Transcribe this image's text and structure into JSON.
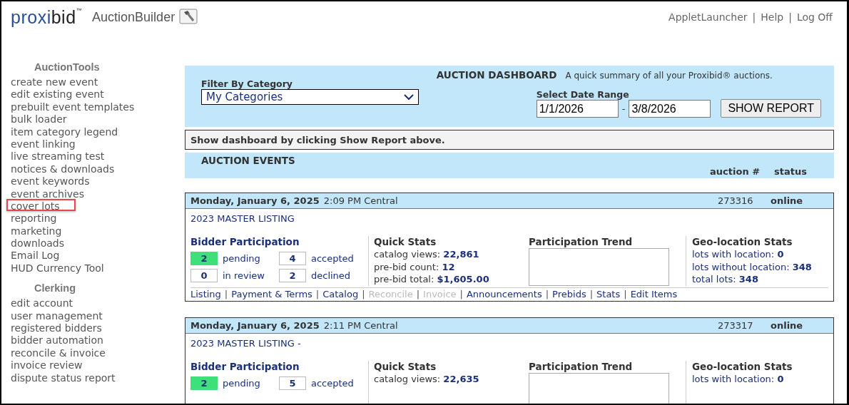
{
  "header": {
    "logo": {
      "first": "proxi",
      "second": "bid",
      "mark": "™"
    },
    "app_name": "AuctionBuilder",
    "links": [
      "AppletLauncher",
      "Help",
      "Log Off"
    ],
    "separator": "|"
  },
  "sidebar": {
    "sections": [
      {
        "title": "AuctionTools",
        "items": [
          {
            "label": "create new event",
            "highlighted": false
          },
          {
            "label": "edit existing event",
            "highlighted": false
          },
          {
            "label": "prebuilt event templates",
            "highlighted": false
          },
          {
            "label": "bulk loader",
            "highlighted": false
          },
          {
            "label": "item category legend",
            "highlighted": false
          },
          {
            "label": "event linking",
            "highlighted": false
          },
          {
            "label": "live streaming test",
            "highlighted": false
          },
          {
            "label": "notices & downloads",
            "highlighted": false
          },
          {
            "label": "event keywords",
            "highlighted": false
          },
          {
            "label": "event archives",
            "highlighted": false
          },
          {
            "label": "cover lots",
            "highlighted": true
          },
          {
            "label": "reporting",
            "highlighted": false
          },
          {
            "label": "marketing",
            "highlighted": false
          },
          {
            "label": "downloads",
            "highlighted": false
          },
          {
            "label": "Email Log",
            "highlighted": false
          },
          {
            "label": "HUD Currency Tool",
            "highlighted": false
          }
        ]
      },
      {
        "title": "Clerking",
        "items": [
          {
            "label": "edit account",
            "highlighted": false
          },
          {
            "label": "user management",
            "highlighted": false
          },
          {
            "label": "registered bidders",
            "highlighted": false
          },
          {
            "label": "bidder automation",
            "highlighted": false
          },
          {
            "label": "reconcile & invoice",
            "highlighted": false
          },
          {
            "label": "invoice review",
            "highlighted": false
          },
          {
            "label": "dispute status report",
            "highlighted": false
          }
        ]
      }
    ]
  },
  "dashboard": {
    "filter_label": "Filter By Category",
    "filter_value": "My Categories",
    "title": "AUCTION DASHBOARD",
    "description": "A quick summary of all your Proxibid® auctions.",
    "date_label": "Select Date Range",
    "date_from": "1/1/2026",
    "date_dash": "-",
    "date_to": "3/8/2026",
    "button": "SHOW REPORT",
    "message": "Show dashboard by clicking Show Report above."
  },
  "events_header": {
    "title": "AUCTION EVENTS",
    "columns": [
      "auction #",
      "status"
    ]
  },
  "events": [
    {
      "date": "Monday, January 6, 2025",
      "time": "2:09 PM Central",
      "auction_number": "273316",
      "status": "online",
      "title": "2023 MASTER LISTING",
      "bidder": {
        "heading": "Bidder Participation",
        "counts": [
          {
            "value": "2",
            "label": "pending",
            "highlighted": true
          },
          {
            "value": "4",
            "label": "accepted",
            "highlighted": false
          },
          {
            "value": "0",
            "label": "in review",
            "highlighted": false
          },
          {
            "value": "2",
            "label": "declined",
            "highlighted": false
          }
        ]
      },
      "quick_stats": {
        "heading": "Quick Stats",
        "rows": [
          {
            "label": "catalog views:",
            "value": "22,861"
          },
          {
            "label": "pre-bid count:",
            "value": "12"
          },
          {
            "label": "pre-bid total:",
            "value": "$1,605.00"
          }
        ]
      },
      "trend": {
        "heading": "Participation Trend"
      },
      "geo": {
        "heading": "Geo-location Stats",
        "rows": [
          {
            "label": "lots with location:",
            "value": "0"
          },
          {
            "label": "lots without location:",
            "value": "348"
          },
          {
            "label": "total lots:",
            "value": "348"
          }
        ]
      },
      "links": [
        {
          "label": "Listing",
          "disabled": false
        },
        {
          "label": "Payment & Terms",
          "disabled": false
        },
        {
          "label": "Catalog",
          "disabled": false
        },
        {
          "label": "Reconcile",
          "disabled": true
        },
        {
          "label": "Invoice",
          "disabled": true
        },
        {
          "label": "Announcements",
          "disabled": false
        },
        {
          "label": "Prebids",
          "disabled": false
        },
        {
          "label": "Stats",
          "disabled": false
        },
        {
          "label": "Edit Items",
          "disabled": false
        }
      ],
      "separator": "|"
    },
    {
      "date": "Monday, January 6, 2025",
      "time": "2:11 PM Central",
      "auction_number": "273317",
      "status": "online",
      "title": "2023 MASTER LISTING -",
      "bidder": {
        "heading": "Bidder Participation",
        "counts": [
          {
            "value": "2",
            "label": "pending",
            "highlighted": true
          },
          {
            "value": "5",
            "label": "accepted",
            "highlighted": false
          }
        ]
      },
      "quick_stats": {
        "heading": "Quick Stats",
        "rows": [
          {
            "label": "catalog views:",
            "value": "22,635"
          }
        ]
      },
      "trend": {
        "heading": "Participation Trend"
      },
      "geo": {
        "heading": "Geo-location Stats",
        "rows": [
          {
            "label": "lots with location:",
            "value": "0"
          }
        ]
      }
    }
  ]
}
